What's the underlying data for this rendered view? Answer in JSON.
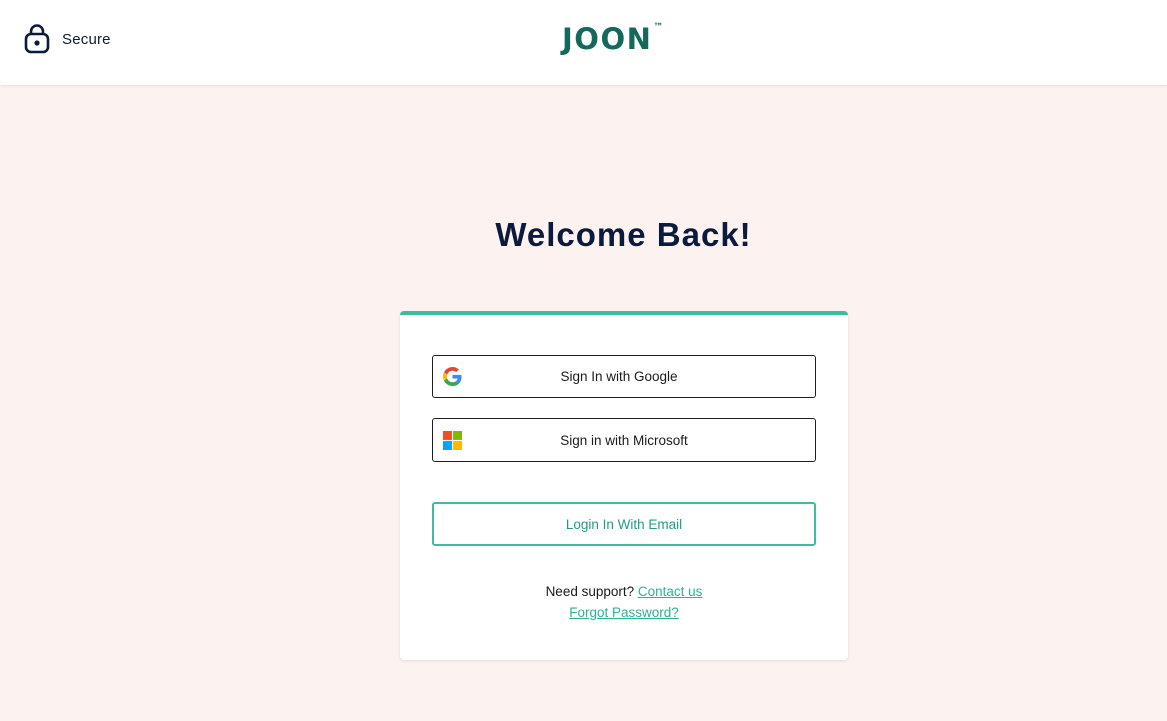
{
  "header": {
    "secure_label": "Secure",
    "logo_text": "JOON",
    "logo_trademark": "™"
  },
  "main": {
    "title": "Welcome Back!"
  },
  "login_card": {
    "google_button_label": "Sign In with Google",
    "microsoft_button_label": "Sign in with Microsoft",
    "email_button_label": "Login In With Email",
    "support_prefix": "Need support?",
    "contact_link": "Contact us",
    "forgot_password_link": "Forgot Password?"
  },
  "colors": {
    "background": "#fcf3f0",
    "brand": "#15695c",
    "accent": "#3dbd9d",
    "heading": "#0c1a3d"
  },
  "icons": {
    "secure": "lock-bag-icon",
    "google": "google-icon",
    "microsoft": "microsoft-icon"
  }
}
